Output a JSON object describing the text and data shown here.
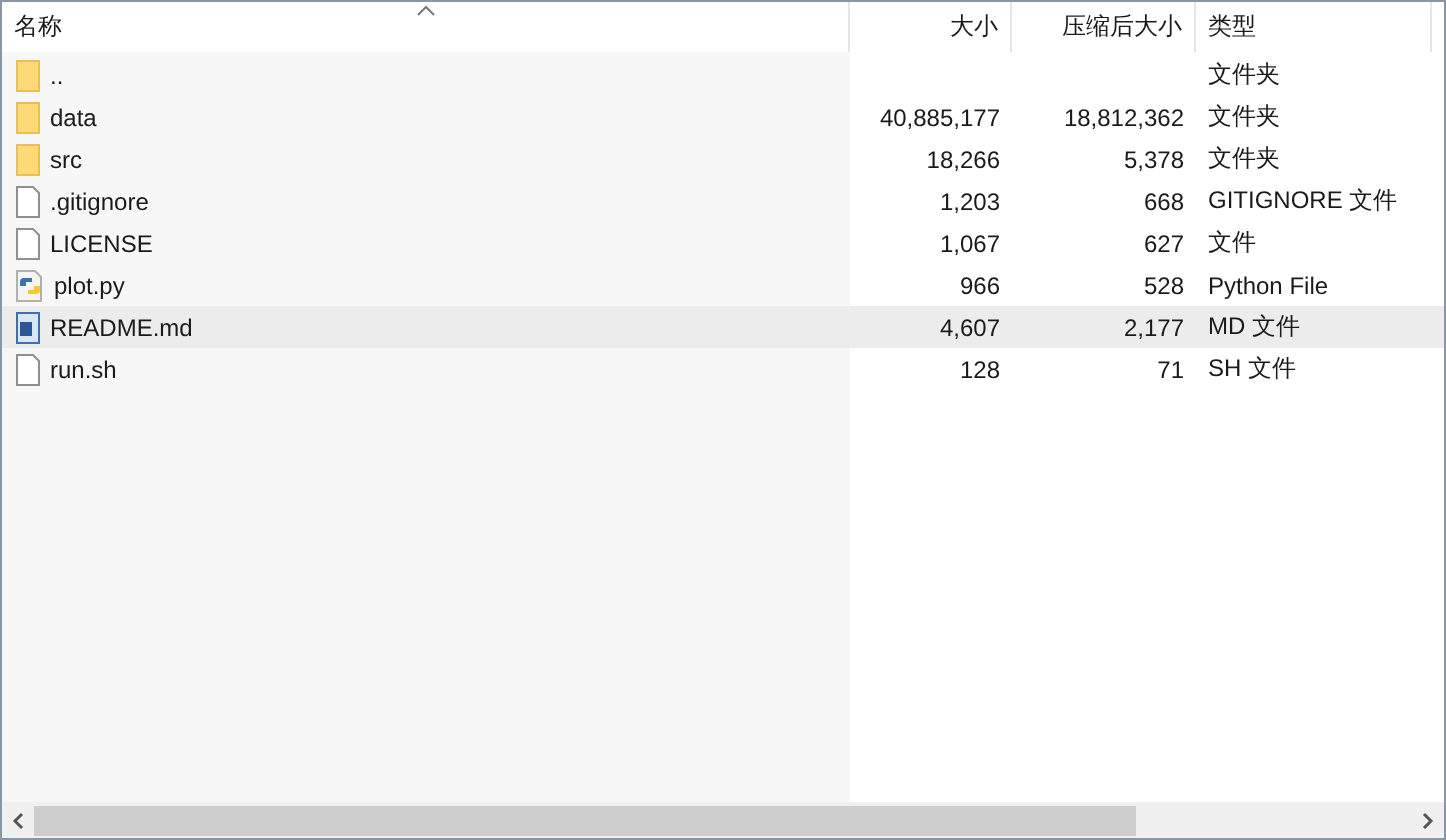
{
  "columns": [
    {
      "label": "名称",
      "sorted": true
    },
    {
      "label": "大小",
      "sorted": false
    },
    {
      "label": "压缩后大小",
      "sorted": false
    },
    {
      "label": "类型",
      "sorted": false
    }
  ],
  "rows": [
    {
      "kind": "folder",
      "name": "..",
      "size": "",
      "packed": "",
      "type": "文件夹",
      "highlighted": false
    },
    {
      "kind": "folder",
      "name": "data",
      "size": "40,885,177",
      "packed": "18,812,362",
      "type": "文件夹",
      "highlighted": false
    },
    {
      "kind": "folder",
      "name": "src",
      "size": "18,266",
      "packed": "5,378",
      "type": "文件夹",
      "highlighted": false
    },
    {
      "kind": "file",
      "name": ".gitignore",
      "size": "1,203",
      "packed": "668",
      "type": "GITIGNORE 文件",
      "highlighted": false
    },
    {
      "kind": "file",
      "name": "LICENSE",
      "size": "1,067",
      "packed": "627",
      "type": "文件",
      "highlighted": false
    },
    {
      "kind": "python",
      "name": "plot.py",
      "size": "966",
      "packed": "528",
      "type": "Python File",
      "highlighted": false
    },
    {
      "kind": "document",
      "name": "README.md",
      "size": "4,607",
      "packed": "2,177",
      "type": "MD 文件",
      "highlighted": true
    },
    {
      "kind": "file",
      "name": "run.sh",
      "size": "128",
      "packed": "71",
      "type": "SH 文件",
      "highlighted": false
    }
  ]
}
